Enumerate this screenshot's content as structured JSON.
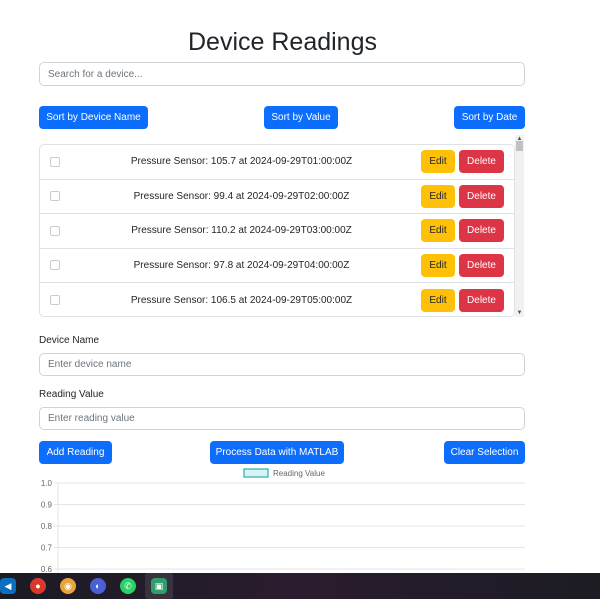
{
  "page": {
    "title": "Device Readings",
    "search_placeholder": "Search for a device..."
  },
  "sort_buttons": {
    "by_name": "Sort by Device Name",
    "by_value": "Sort by Value",
    "by_date": "Sort by Date"
  },
  "readings": [
    {
      "text": "Pressure Sensor: 105.7 at 2024-09-29T01:00:00Z",
      "edit": "Edit",
      "delete": "Delete",
      "checked": false
    },
    {
      "text": "Pressure Sensor: 99.4 at 2024-09-29T02:00:00Z",
      "edit": "Edit",
      "delete": "Delete",
      "checked": false
    },
    {
      "text": "Pressure Sensor: 110.2 at 2024-09-29T03:00:00Z",
      "edit": "Edit",
      "delete": "Delete",
      "checked": false
    },
    {
      "text": "Pressure Sensor: 97.8 at 2024-09-29T04:00:00Z",
      "edit": "Edit",
      "delete": "Delete",
      "checked": false
    },
    {
      "text": "Pressure Sensor: 106.5 at 2024-09-29T05:00:00Z",
      "edit": "Edit",
      "delete": "Delete",
      "checked": false
    }
  ],
  "form": {
    "device_name_label": "Device Name",
    "device_name_placeholder": "Enter device name",
    "reading_value_label": "Reading Value",
    "reading_value_placeholder": "Enter reading value"
  },
  "actions": {
    "add": "Add Reading",
    "process": "Process Data with MATLAB",
    "clear": "Clear Selection"
  },
  "colors": {
    "primary": "#0d6efd",
    "warning": "#ffc107",
    "danger": "#dc3545",
    "chart_line": "#4bc0c0"
  },
  "chart_data": {
    "type": "line",
    "legend": [
      "Reading Value"
    ],
    "series": [
      {
        "name": "Reading Value",
        "values": []
      }
    ],
    "yticks": [
      "1.0",
      "0.9",
      "0.8",
      "0.7",
      "0.6"
    ],
    "ylim": [
      0.6,
      1.0
    ],
    "legend_position": "top",
    "grid": true
  },
  "taskbar": {
    "icons": [
      "vscode-icon",
      "app-icon-1",
      "chrome-icon",
      "app-icon-2",
      "whatsapp-icon",
      "app-icon-3"
    ]
  }
}
